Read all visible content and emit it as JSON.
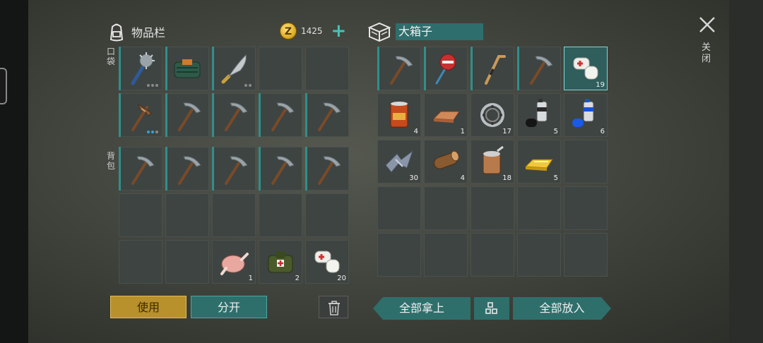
{
  "inventory": {
    "title": "物品栏",
    "coins": "1425",
    "pocket_label": "口袋",
    "backpack_label": "背包",
    "pocket_slots": [
      {
        "item": "spiked-mace-icon",
        "durability": [
          false,
          false,
          false
        ],
        "equipped": true
      },
      {
        "item": "supply-bag-icon",
        "equipped": true
      },
      {
        "item": "machete-icon",
        "durability": [
          false,
          false
        ],
        "equipped": true
      },
      {
        "item": ""
      },
      {
        "item": ""
      },
      {
        "item": "crafted-pickaxe-icon",
        "durability": [
          true,
          true,
          false
        ],
        "equipped": true
      },
      {
        "item": "pickaxe-icon",
        "equipped": true
      },
      {
        "item": "pickaxe-icon",
        "equipped": true
      },
      {
        "item": "pickaxe-icon",
        "equipped": true
      },
      {
        "item": "pickaxe-icon",
        "equipped": true
      }
    ],
    "backpack_slots": [
      {
        "item": "pickaxe-icon",
        "equipped": true
      },
      {
        "item": "pickaxe-icon",
        "equipped": true
      },
      {
        "item": "pickaxe-icon",
        "equipped": true
      },
      {
        "item": "pickaxe-icon",
        "equipped": true
      },
      {
        "item": "pickaxe-icon",
        "equipped": true
      },
      {
        "item": ""
      },
      {
        "item": ""
      },
      {
        "item": ""
      },
      {
        "item": ""
      },
      {
        "item": ""
      },
      {
        "item": ""
      },
      {
        "item": ""
      },
      {
        "item": "roast-chicken-icon",
        "count": "1"
      },
      {
        "item": "medkit-bag-icon",
        "count": "2"
      },
      {
        "item": "bandage-icon",
        "count": "20"
      }
    ]
  },
  "box": {
    "title": "大箱子",
    "slots": [
      {
        "item": "pickaxe-icon",
        "equipped": true
      },
      {
        "item": "stop-sign-icon",
        "equipped": true
      },
      {
        "item": "hockey-stick-icon",
        "equipped": true
      },
      {
        "item": "pickaxe-icon",
        "equipped": true
      },
      {
        "item": "bandage-icon",
        "count": "19",
        "selected": true
      },
      {
        "item": "canned-food-icon",
        "count": "4"
      },
      {
        "item": "copper-ingot-icon",
        "count": "1"
      },
      {
        "item": "bearing-icon",
        "count": "17"
      },
      {
        "item": "black-spray-can-icon",
        "count": "5"
      },
      {
        "item": "blue-spray-can-icon",
        "count": "6"
      },
      {
        "item": "scrap-metal-icon",
        "count": "30"
      },
      {
        "item": "log-icon",
        "count": "4"
      },
      {
        "item": "open-can-icon",
        "count": "18"
      },
      {
        "item": "gold-ingot-icon",
        "count": "5"
      },
      {
        "item": ""
      },
      {
        "item": ""
      },
      {
        "item": ""
      },
      {
        "item": ""
      },
      {
        "item": ""
      },
      {
        "item": ""
      },
      {
        "item": ""
      },
      {
        "item": ""
      },
      {
        "item": ""
      },
      {
        "item": ""
      },
      {
        "item": ""
      }
    ]
  },
  "buttons": {
    "use": "使用",
    "split": "分开",
    "take_all": "全部拿上",
    "put_all": "全部放入",
    "close": "关闭"
  },
  "colors": {
    "accent": "#2e6f6c",
    "gold": "#b8902c",
    "selected": "#7fd8d2"
  }
}
